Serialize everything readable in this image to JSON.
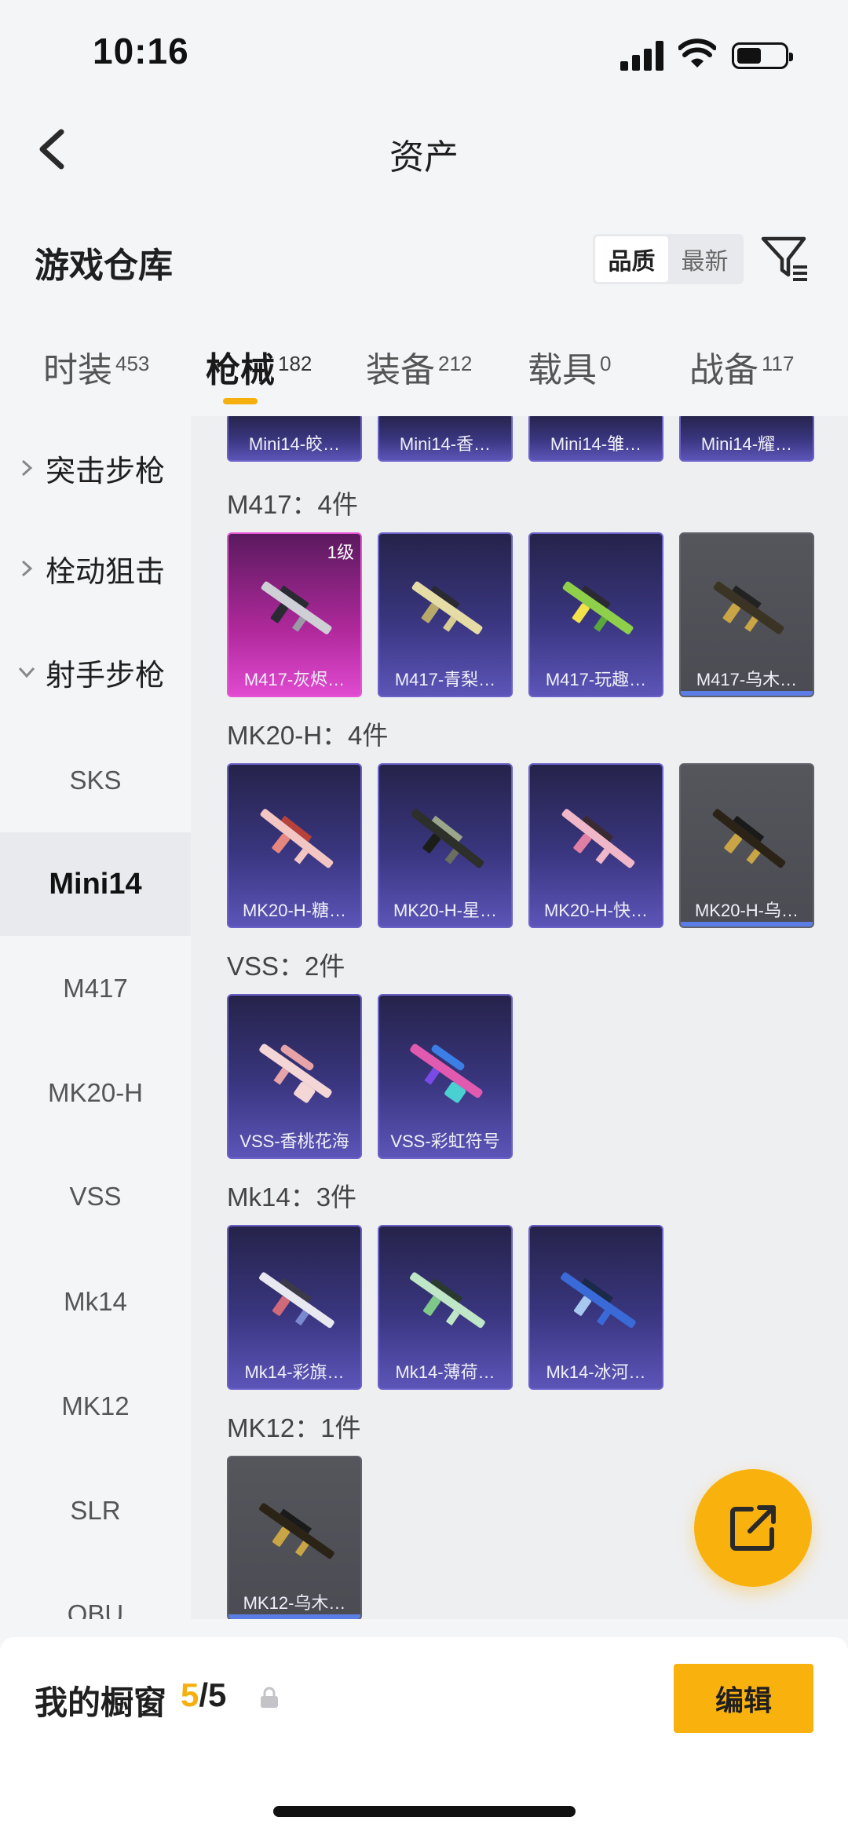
{
  "status": {
    "time": "10:16"
  },
  "nav": {
    "title": "资产",
    "back_icon": "chevron-left-icon"
  },
  "header": {
    "title": "游戏仓库",
    "sort_options": [
      "品质",
      "最新"
    ],
    "sort_active": "品质",
    "filter_icon": "filter-icon"
  },
  "tabs": [
    {
      "label": "时装",
      "count": "453"
    },
    {
      "label": "枪械",
      "count": "182"
    },
    {
      "label": "装备",
      "count": "212"
    },
    {
      "label": "载具",
      "count": "0"
    },
    {
      "label": "战备",
      "count": "117"
    }
  ],
  "active_tab": "枪械",
  "sidebar": {
    "groups": [
      "突击步枪",
      "栓动狙击",
      "射手步枪"
    ],
    "items": [
      "SKS",
      "Mini14",
      "M417",
      "MK20-H",
      "VSS",
      "Mk14",
      "MK12",
      "SLR",
      "QBU"
    ],
    "active_item": "Mini14"
  },
  "content": {
    "partial_row": [
      "Mini14-皎…",
      "Mini14-香…",
      "Mini14-雏…",
      "Mini14-耀…"
    ],
    "groups": [
      {
        "title": "M417：4件",
        "items": [
          {
            "label": "M417-灰烬…",
            "level": "1级"
          },
          {
            "label": "M417-青梨…"
          },
          {
            "label": "M417-玩趣…"
          },
          {
            "label": "M417-乌木…"
          }
        ]
      },
      {
        "title": "MK20-H：4件",
        "items": [
          {
            "label": "MK20-H-糖…"
          },
          {
            "label": "MK20-H-星…"
          },
          {
            "label": "MK20-H-快…"
          },
          {
            "label": "MK20-H-乌…"
          }
        ]
      },
      {
        "title": "VSS：2件",
        "items": [
          {
            "label": "VSS-香桃花海"
          },
          {
            "label": "VSS-彩虹符号"
          }
        ]
      },
      {
        "title": "Mk14：3件",
        "items": [
          {
            "label": "Mk14-彩旗…"
          },
          {
            "label": "Mk14-薄荷…"
          },
          {
            "label": "Mk14-冰河…"
          }
        ]
      },
      {
        "title": "MK12：1件",
        "items": [
          {
            "label": "MK12-乌木…"
          }
        ]
      }
    ]
  },
  "fab": {
    "icon": "share-external-icon"
  },
  "bottom": {
    "label": "我的橱窗",
    "current": "5",
    "total": "/5",
    "lock_icon": "lock-icon",
    "edit_label": "编辑"
  },
  "colors": {
    "accent": "#f9b10e",
    "card_purple": "#3a3680",
    "card_pink": "#b0299c",
    "card_gray": "#4b4c53"
  }
}
